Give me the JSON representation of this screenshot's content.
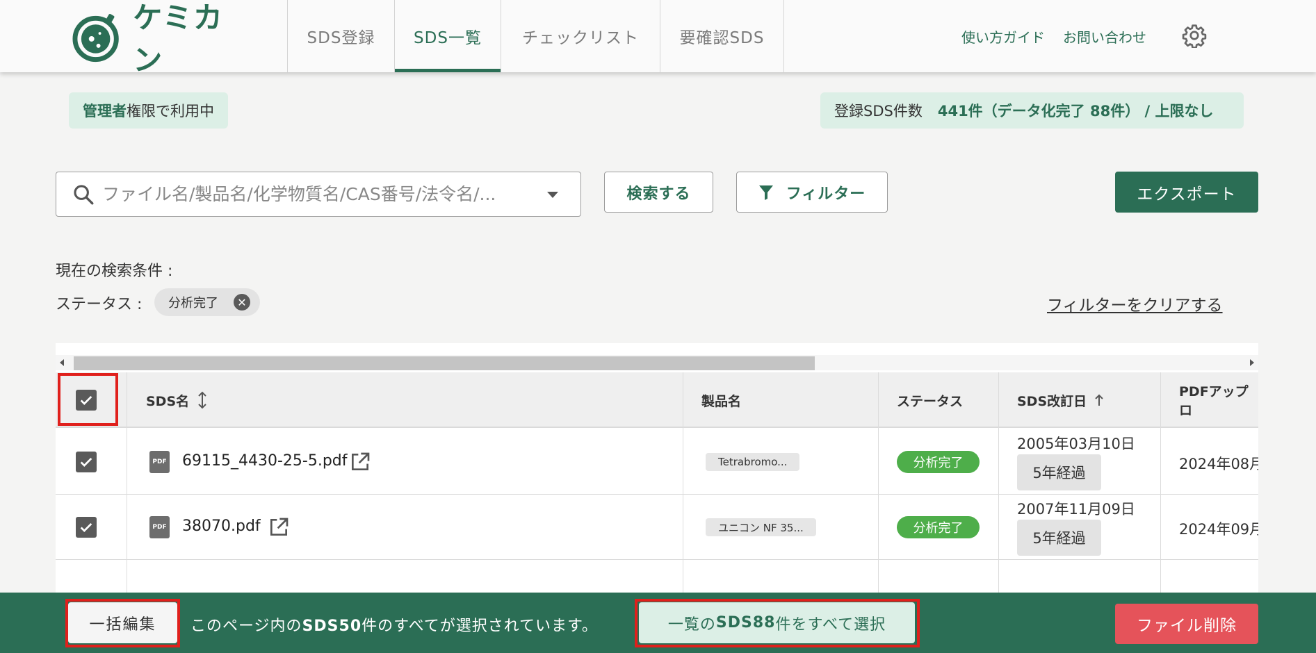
{
  "header": {
    "logo_text": "ケミカン",
    "tabs": [
      {
        "label": "SDS登録"
      },
      {
        "label": "SDS一覧"
      },
      {
        "label": "チェックリスト"
      },
      {
        "label": "要確認SDS"
      }
    ],
    "guide_link": "使い方ガイド",
    "contact_link": "お問い合わせ",
    "accent_color": "#2b6e55"
  },
  "info": {
    "role_strong": "管理者",
    "role_rest": "権限で利用中",
    "count_label": "登録SDS件数",
    "count_value": "441件（データ化完了 88件） / 上限なし"
  },
  "search": {
    "placeholder": "ファイル名/製品名/化学物質名/CAS番号/法令名/...",
    "search_button": "検索する",
    "filter_button": "フィルター",
    "export_button": "エクスポート"
  },
  "conditions": {
    "title": "現在の検索条件 :",
    "status_label": "ステータス :",
    "status_chip": "分析完了",
    "clear_link": "フィルターをクリアする"
  },
  "table": {
    "columns": {
      "sds_name": "SDS名",
      "product": "製品名",
      "status": "ステータス",
      "revision": "SDS改訂日",
      "upload": "PDFアップロ"
    },
    "rows": [
      {
        "file": "69115_4430-25-5.pdf",
        "product": "Tetrabromo...",
        "status": "分析完了",
        "revision_date": "2005年03月10日",
        "elapsed": "5年経過",
        "upload_date": "2024年08月"
      },
      {
        "file": "38070.pdf",
        "product": "ユニコン NF 35...",
        "status": "分析完了",
        "revision_date": "2007年11月09日",
        "elapsed": "5年経過",
        "upload_date": "2024年09月"
      }
    ],
    "pdf_icon_text": "PDF"
  },
  "bottom_bar": {
    "bulk_edit": "一括編集",
    "message_pre": "このページ内の",
    "message_count": "SDS50",
    "message_post": "件のすべてが選択されています。",
    "select_all_pre": "一覧の",
    "select_all_count": "SDS88",
    "select_all_post": "件をすべて選択",
    "delete_button": "ファイル削除",
    "delete_color": "#e5535a"
  }
}
